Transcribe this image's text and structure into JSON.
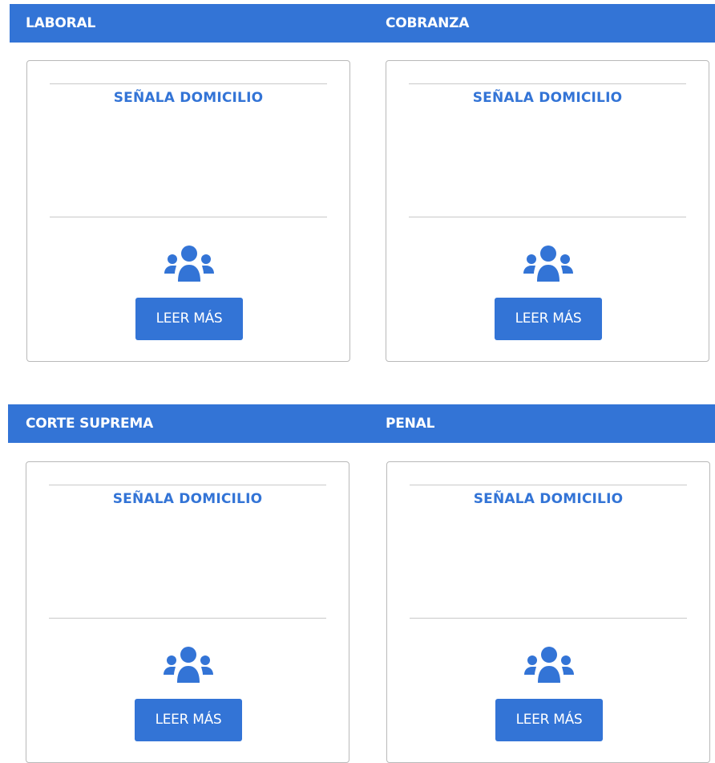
{
  "sections": [
    {
      "label": "LABORAL"
    },
    {
      "label": "COBRANZA"
    },
    {
      "label": "CORTE SUPREMA"
    },
    {
      "label": "PENAL"
    }
  ],
  "cards": [
    {
      "title": "SEÑALA DOMICILIO",
      "icon": "users-icon",
      "button_label": "LEER MÁS"
    },
    {
      "title": "SEÑALA DOMICILIO",
      "icon": "users-icon",
      "button_label": "LEER MÁS"
    },
    {
      "title": "SEÑALA DOMICILIO",
      "icon": "users-icon",
      "button_label": "LEER MÁS"
    },
    {
      "title": "SEÑALA DOMICILIO",
      "icon": "users-icon",
      "button_label": "LEER MÁS"
    }
  ],
  "colors": {
    "accent": "#3374d6",
    "card_border": "#b9b9b9",
    "divider": "#c9c9c9"
  }
}
